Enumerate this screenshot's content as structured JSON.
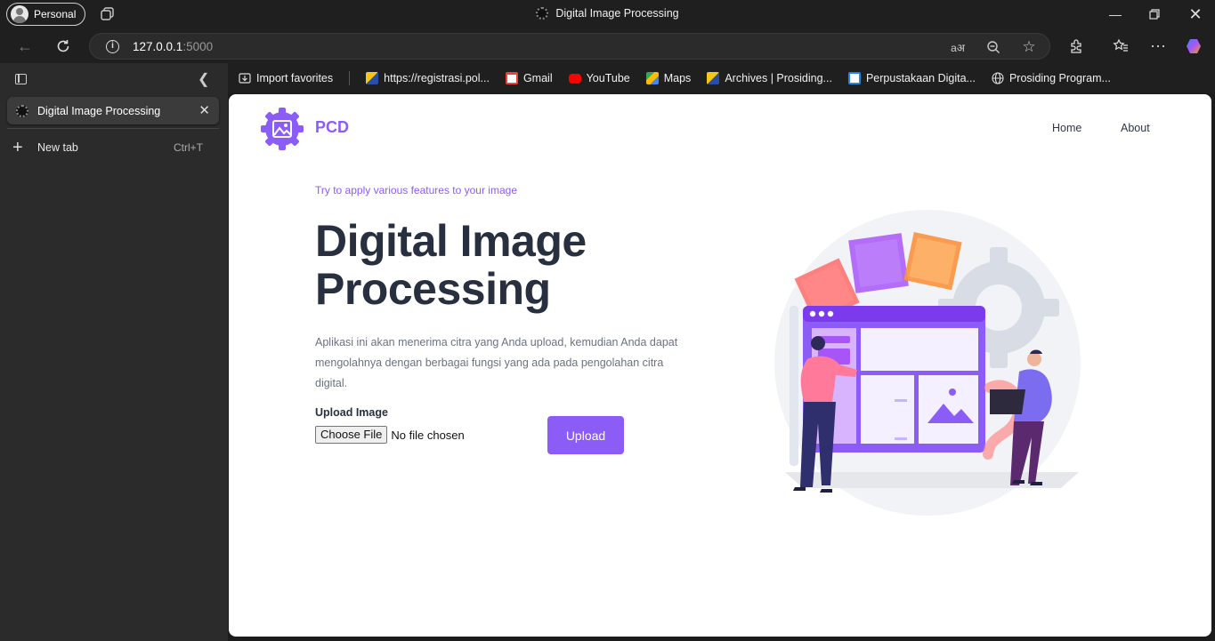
{
  "window": {
    "profile_label": "Personal",
    "title": "Digital Image Processing"
  },
  "toolbar": {
    "url_host": "127.0.0.1",
    "url_port": ":5000"
  },
  "bookmarks": [
    {
      "label": "Import favorites",
      "icon": "import-icon"
    },
    {
      "label": "https://registrasi.pol...",
      "icon": "site-icon",
      "color": "#2a4ea8"
    },
    {
      "label": "Gmail",
      "icon": "gmail-icon",
      "color": "#ea4335"
    },
    {
      "label": "YouTube",
      "icon": "youtube-icon",
      "color": "#ff0000"
    },
    {
      "label": "Maps",
      "icon": "maps-icon",
      "color": "#34a853"
    },
    {
      "label": "Archives | Prosiding...",
      "icon": "site-icon",
      "color": "#2a4ea8"
    },
    {
      "label": "Perpustakaan Digita...",
      "icon": "library-icon",
      "color": "#1e88e5"
    },
    {
      "label": "Prosiding Program...",
      "icon": "globe-icon"
    }
  ],
  "sidebar": {
    "active_tab": "Digital Image Processing",
    "new_tab_label": "New tab",
    "new_tab_shortcut": "Ctrl+T"
  },
  "page": {
    "brand": "PCD",
    "nav": [
      "Home",
      "About"
    ],
    "eyebrow": "Try to apply various features to your image",
    "title_line1": "Digital Image",
    "title_line2": "Processing",
    "description": "Aplikasi ini akan menerima citra yang Anda upload, kemudian Anda dapat mengolahnya dengan berbagai fungsi yang ada pada pengolahan citra digital.",
    "upload_label": "Upload Image",
    "choose_file": "Choose File",
    "no_file": "No file chosen",
    "upload_button": "Upload",
    "accent_color": "#8b5cf6"
  }
}
